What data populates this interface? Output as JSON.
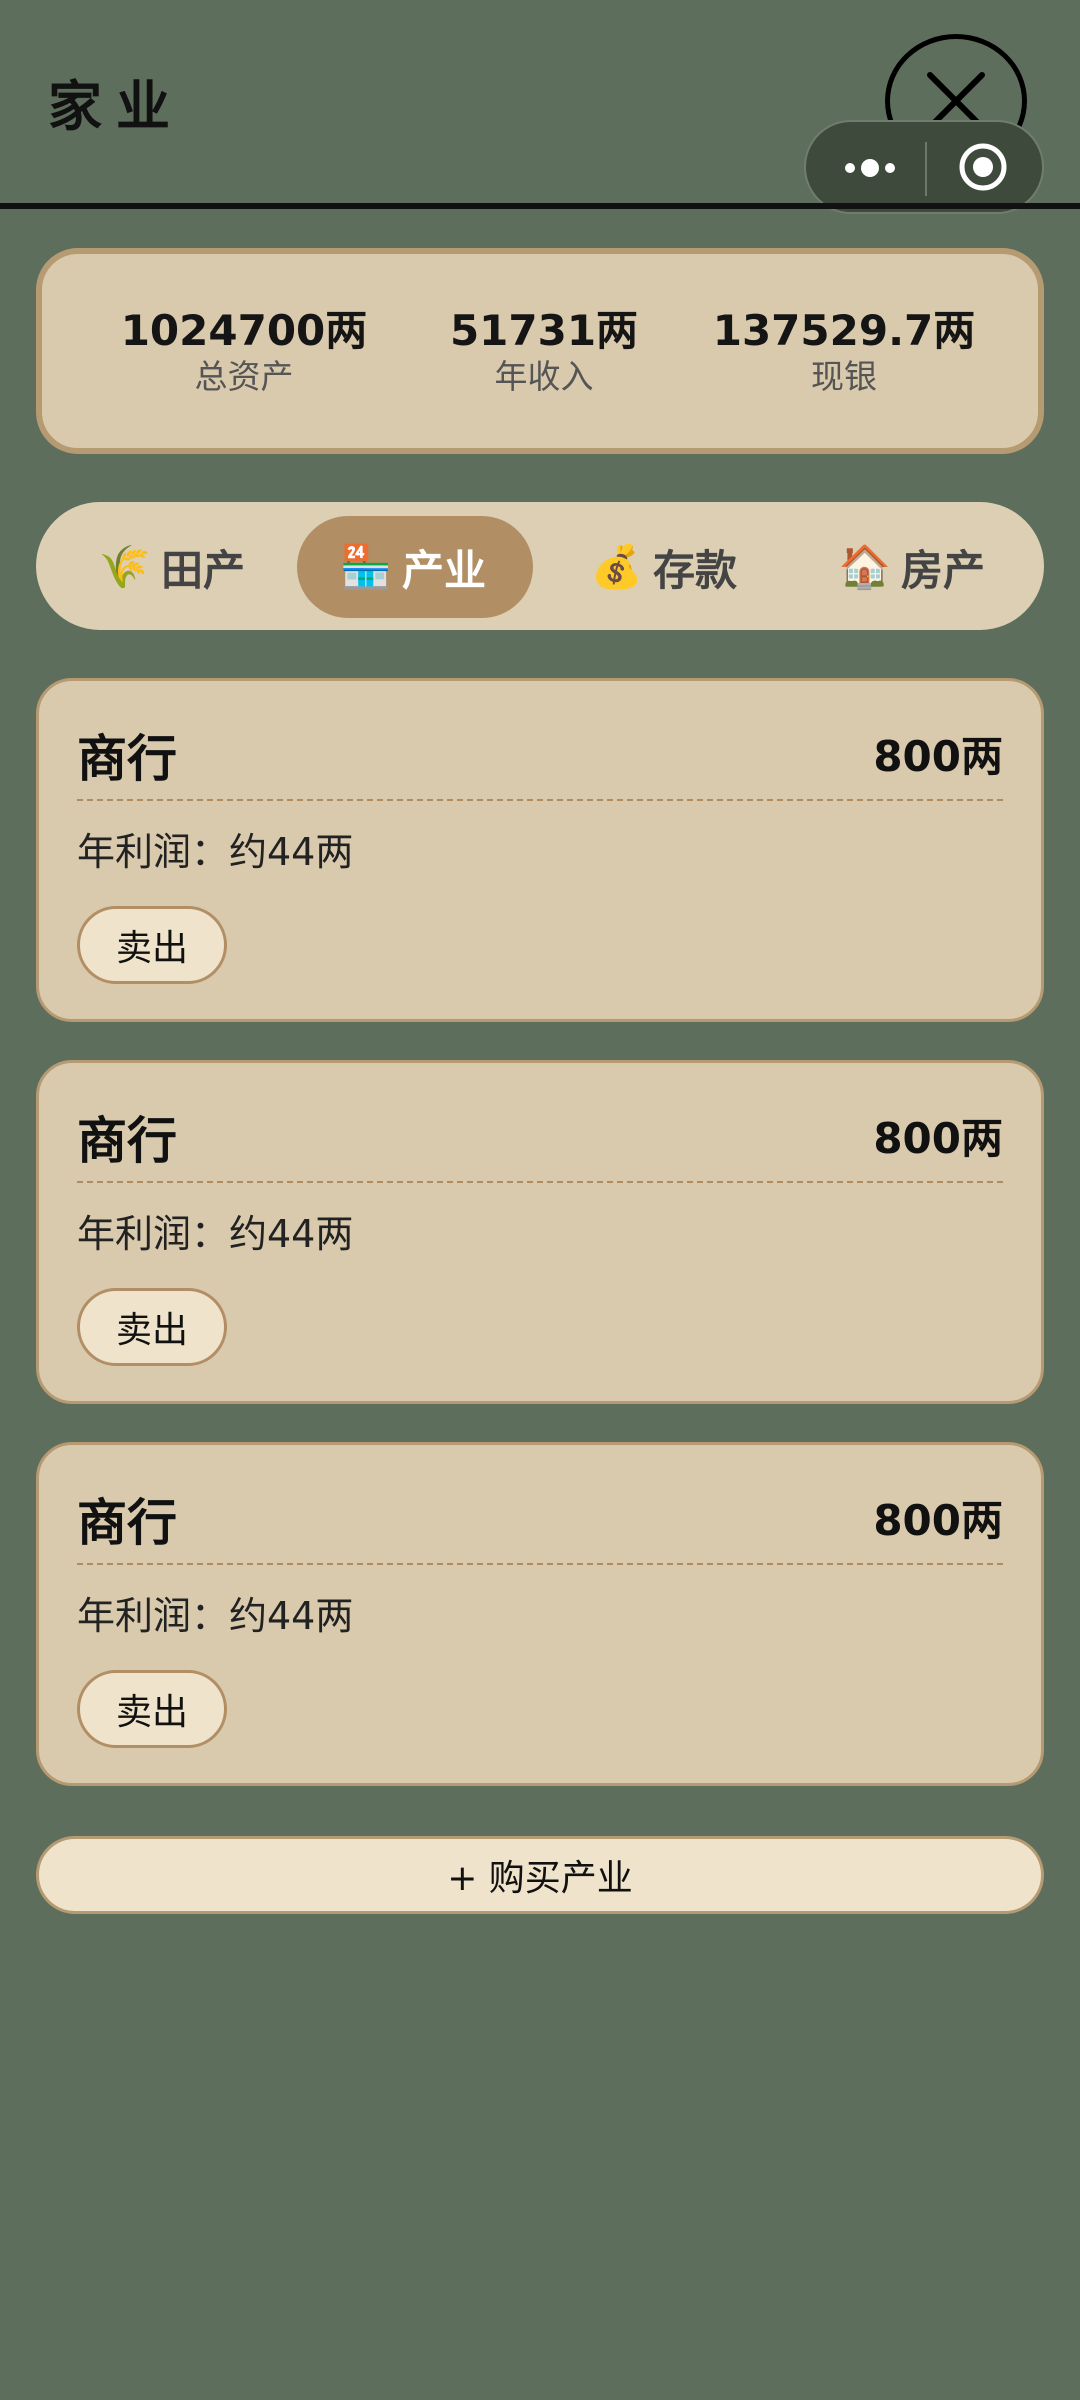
{
  "header": {
    "title": "家业"
  },
  "stats": [
    {
      "value": "1024700两",
      "label": "总资产"
    },
    {
      "value": "51731两",
      "label": "年收入"
    },
    {
      "value": "137529.7两",
      "label": "现银"
    }
  ],
  "tabs": [
    {
      "icon": "🌾",
      "label": "田产",
      "active": false
    },
    {
      "icon": "🏪",
      "label": "产业",
      "active": true
    },
    {
      "icon": "💰",
      "label": "存款",
      "active": false
    },
    {
      "icon": "🏠",
      "label": "房产",
      "active": false
    }
  ],
  "businesses": [
    {
      "name": "商行",
      "price": "800两",
      "profit": "年利润：约44两",
      "sell_label": "卖出"
    },
    {
      "name": "商行",
      "price": "800两",
      "profit": "年利润：约44两",
      "sell_label": "卖出"
    },
    {
      "name": "商行",
      "price": "800两",
      "profit": "年利润：约44两",
      "sell_label": "卖出"
    }
  ],
  "buy_button": {
    "label": "+ 购买产业"
  },
  "icons": {
    "close": "close-icon",
    "more": "more-dots-icon",
    "target": "record-target-icon"
  },
  "colors": {
    "background": "#5e6e5c",
    "card": "#d9caad",
    "accent": "#b28e64"
  }
}
